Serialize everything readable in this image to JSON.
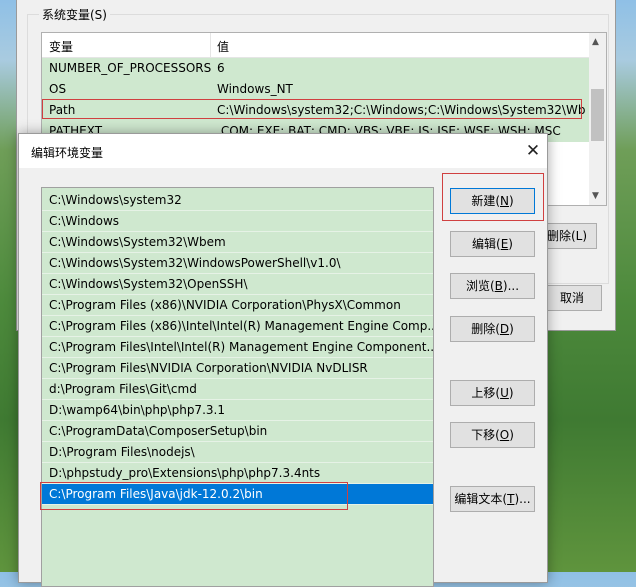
{
  "system_vars": {
    "group_title": "系统变量(S)",
    "col_variable": "变量",
    "col_value": "值",
    "rows": [
      {
        "name": "NUMBER_OF_PROCESSORS",
        "value": "6"
      },
      {
        "name": "OS",
        "value": "Windows_NT"
      },
      {
        "name": "Path",
        "value": "C:\\Windows\\system32;C:\\Windows;C:\\Windows\\System32\\Wb..."
      },
      {
        "name": "PATHEXT",
        "value": ".COM;.EXE;.BAT;.CMD;.VBS;.VBE;.JS;.JSE;.WSF;.WSH;.MSC"
      }
    ],
    "delete_label": "删除(L)",
    "cancel_label": "取消"
  },
  "dialog": {
    "title": "编辑环境变量",
    "close_glyph": "✕",
    "paths": [
      "C:\\Windows\\system32",
      "C:\\Windows",
      "C:\\Windows\\System32\\Wbem",
      "C:\\Windows\\System32\\WindowsPowerShell\\v1.0\\",
      "C:\\Windows\\System32\\OpenSSH\\",
      "C:\\Program Files (x86)\\NVIDIA Corporation\\PhysX\\Common",
      "C:\\Program Files (x86)\\Intel\\Intel(R) Management Engine Comp...",
      "C:\\Program Files\\Intel\\Intel(R) Management Engine Component...",
      "C:\\Program Files\\NVIDIA Corporation\\NVIDIA NvDLISR",
      "d:\\Program Files\\Git\\cmd",
      "D:\\wamp64\\bin\\php\\php7.3.1",
      "C:\\ProgramData\\ComposerSetup\\bin",
      "D:\\Program Files\\nodejs\\",
      "D:\\phpstudy_pro\\Extensions\\php\\php7.3.4nts",
      "C:\\Program Files\\Java\\jdk-12.0.2\\bin"
    ],
    "selected_index": 14,
    "buttons": {
      "new": {
        "text": "新建(",
        "key": "N",
        "tail": ")"
      },
      "edit": {
        "text": "编辑(",
        "key": "E",
        "tail": ")"
      },
      "browse": {
        "text": "浏览(",
        "key": "B",
        "tail": ")..."
      },
      "delete": {
        "text": "删除(",
        "key": "D",
        "tail": ")"
      },
      "move_up": {
        "text": "上移(",
        "key": "U",
        "tail": ")"
      },
      "move_down": {
        "text": "下移(",
        "key": "O",
        "tail": ")"
      },
      "edit_text": {
        "text": "编辑文本(",
        "key": "T",
        "tail": ")..."
      }
    }
  },
  "colors": {
    "list_background": "#cfe8cf",
    "selection": "#0078d7",
    "highlight_outline": "#d04040"
  }
}
